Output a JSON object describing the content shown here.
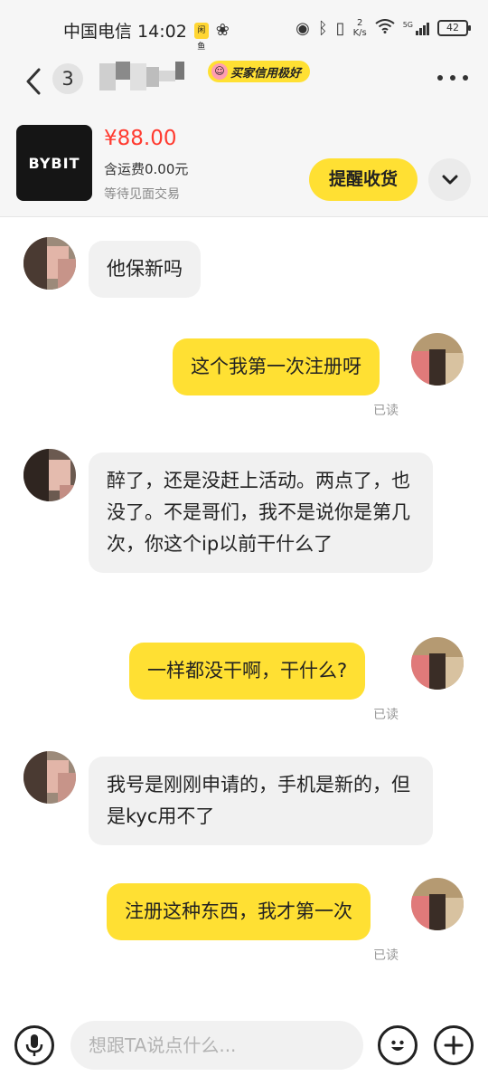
{
  "status_bar": {
    "carrier_time": "中国电信 14:02",
    "app_badge": "闲鱼",
    "speed_top": "2",
    "speed_bottom": "K/s",
    "signal_label": "5G",
    "battery": "42"
  },
  "header": {
    "unread_count": "3",
    "credit_badge": "买家信用极好"
  },
  "product": {
    "brand_logo": "BYBIT",
    "price": "¥88.00",
    "shipping": "含运费0.00元",
    "status": "等待见面交易",
    "remind_button": "提醒收货"
  },
  "messages": [
    {
      "side": "in",
      "text": "他保新吗"
    },
    {
      "side": "out",
      "text": "这个我第一次注册呀",
      "read": "已读"
    },
    {
      "side": "in",
      "text": "醉了，还是没赶上活动。两点了，也没了。不是哥们，我不是说你是第几次，你这个ip以前干什么了"
    },
    {
      "side": "out",
      "text": "一样都没干啊，干什么?",
      "read": "已读"
    },
    {
      "side": "in",
      "text": "我号是刚刚申请的，手机是新的，但是kyc用不了"
    },
    {
      "side": "out",
      "text": "注册这种东西，我才第一次",
      "read": "已读"
    }
  ],
  "input": {
    "placeholder": "想跟TA说点什么..."
  },
  "colors": {
    "accent_yellow": "#ffe033",
    "price_red": "#ff3b30",
    "bubble_gray": "#f1f1f1"
  },
  "icons": [
    "back-icon",
    "more-icon",
    "chevron-down-icon",
    "microphone-icon",
    "emoji-icon",
    "plus-icon"
  ]
}
